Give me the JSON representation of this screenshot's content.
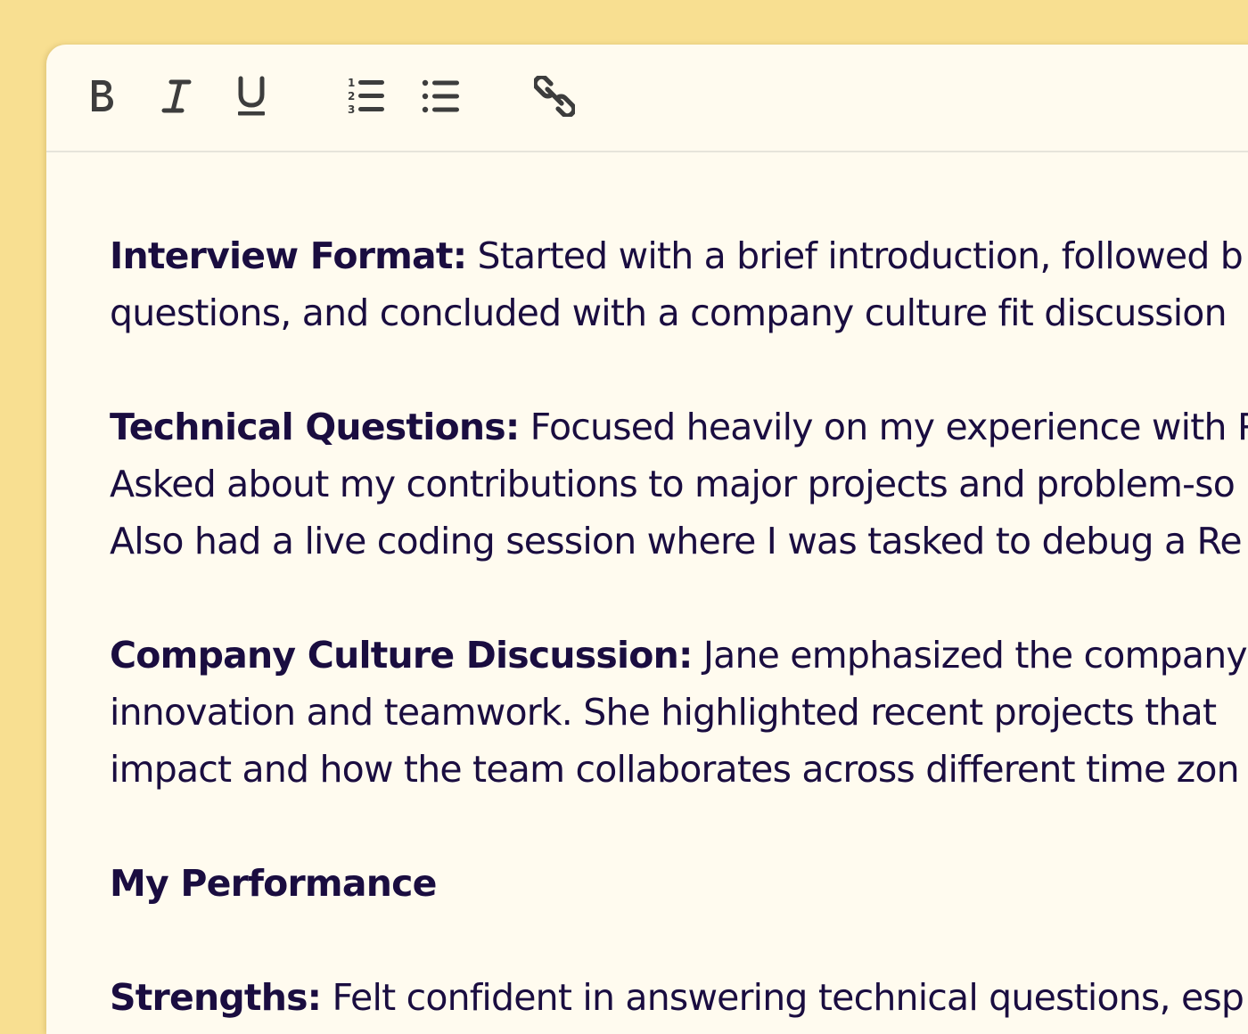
{
  "toolbar": {
    "buttons": [
      {
        "name": "bold",
        "icon": "bold-icon"
      },
      {
        "name": "italic",
        "icon": "italic-icon"
      },
      {
        "name": "underline",
        "icon": "underline-icon"
      },
      {
        "name": "numbered-list",
        "icon": "numbered-list-icon"
      },
      {
        "name": "bulleted-list",
        "icon": "bulleted-list-icon"
      },
      {
        "name": "link",
        "icon": "link-icon"
      }
    ],
    "icon_color": "#3d3d3d"
  },
  "content": {
    "text_color": "#1a0d40",
    "interview_format": {
      "label": "Interview Format:",
      "line1": " Started with a brief introduction, followed b",
      "line2": "questions, and concluded with a company culture fit discussion"
    },
    "technical_questions": {
      "label": "Technical Questions:",
      "line1": " Focused heavily on my experience with Re",
      "line2": "Asked about my contributions to major projects and problem-so",
      "line3": "Also had a live coding session where I was tasked to debug a Re"
    },
    "culture_discussion": {
      "label": "Company Culture Discussion:",
      "line1": " Jane emphasized the company's",
      "line2": "innovation and teamwork. She highlighted recent projects that",
      "line3": "impact and how the team collaborates across different time zon"
    },
    "my_performance_heading": "My Performance",
    "strengths": {
      "label": "Strengths:",
      "line1": " Felt confident in answering technical questions, esp"
    }
  },
  "colors": {
    "background": "#f8df91",
    "panel": "#fffbef",
    "divider": "#e6e4db"
  }
}
